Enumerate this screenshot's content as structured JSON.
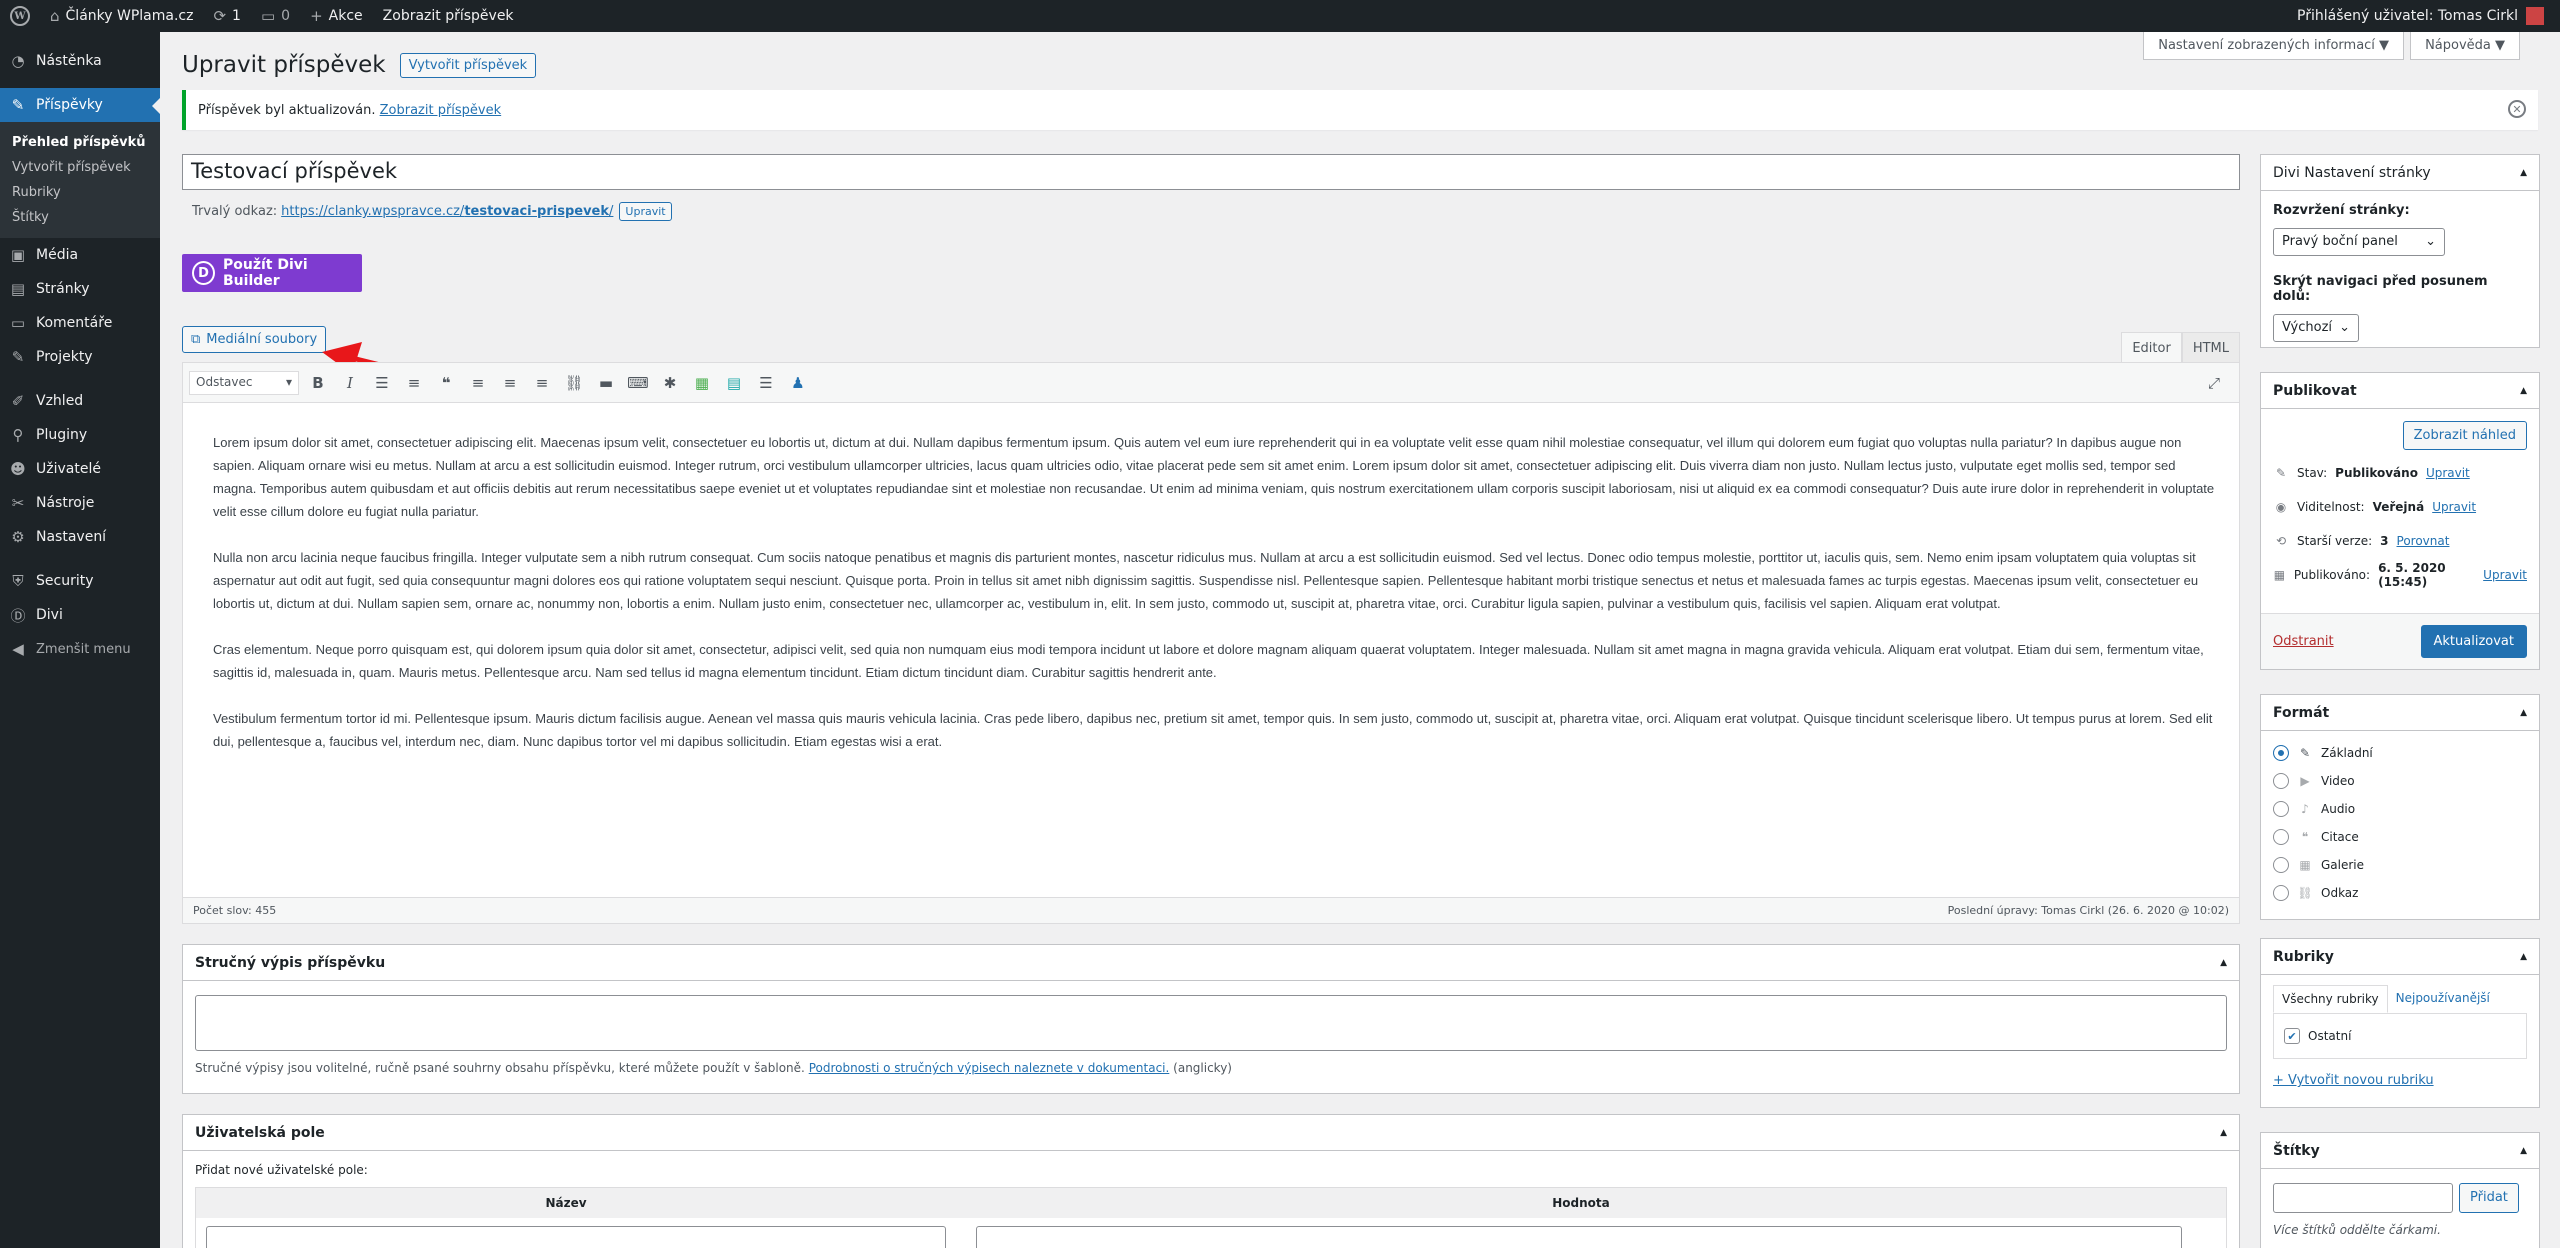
{
  "adminbar": {
    "site": "Články WPlama.cz",
    "updates": "1",
    "comments": "0",
    "new": "Akce",
    "view_post": "Zobrazit příspěvek",
    "greeting": "Přihlášený uživatel: Tomas Cirkl"
  },
  "sidebar": {
    "items": [
      {
        "label": "Nástěnka",
        "icon": "dashboard-icon"
      },
      {
        "label": "Příspěvky",
        "icon": "pin-icon"
      },
      {
        "label": "Média",
        "icon": "media-icon"
      },
      {
        "label": "Stránky",
        "icon": "pages-icon"
      },
      {
        "label": "Komentáře",
        "icon": "comments-icon"
      },
      {
        "label": "Projekty",
        "icon": "pin-icon"
      },
      {
        "label": "Vzhled",
        "icon": "appearance-icon"
      },
      {
        "label": "Pluginy",
        "icon": "plugins-icon"
      },
      {
        "label": "Uživatelé",
        "icon": "users-icon"
      },
      {
        "label": "Nástroje",
        "icon": "tools-icon"
      },
      {
        "label": "Nastavení",
        "icon": "settings-icon"
      },
      {
        "label": "Security",
        "icon": "shield-icon"
      },
      {
        "label": "Divi",
        "icon": "divi-icon"
      },
      {
        "label": "Zmenšit menu",
        "icon": "collapse-icon"
      }
    ],
    "submenu": [
      "Přehled příspěvků",
      "Vytvořit příspěvek",
      "Rubriky",
      "Štítky"
    ]
  },
  "header": {
    "title": "Upravit příspěvek",
    "add_new": "Vytvořit příspěvek",
    "screen_options": "Nastavení zobrazených informací ▼",
    "help": "Nápověda ▼"
  },
  "notice": {
    "text": "Příspěvek byl aktualizován.",
    "link": "Zobrazit příspěvek"
  },
  "post": {
    "title": "Testovací příspěvek",
    "permalink_label": "Trvalý odkaz:",
    "permalink_base": "https://clanky.wpspravce.cz/",
    "permalink_slug": "testovaci-prispevek",
    "permalink_end": "/",
    "permalink_edit": "Upravit"
  },
  "divi_button": "Použít Divi Builder",
  "media_button": "Mediální soubory",
  "editor": {
    "tab_visual": "Editor",
    "tab_html": "HTML",
    "format": "Odstavec",
    "paragraphs": [
      "Lorem ipsum dolor sit amet, consectetuer adipiscing elit. Maecenas ipsum velit, consectetuer eu lobortis ut, dictum at dui. Nullam dapibus fermentum ipsum. Quis autem vel eum iure reprehenderit qui in ea voluptate velit esse quam nihil molestiae consequatur, vel illum qui dolorem eum fugiat quo voluptas nulla pariatur? In dapibus augue non sapien. Aliquam ornare wisi eu metus. Nullam at arcu a est sollicitudin euismod. Integer rutrum, orci vestibulum ullamcorper ultricies, lacus quam ultricies odio, vitae placerat pede sem sit amet enim. Lorem ipsum dolor sit amet, consectetuer adipiscing elit. Duis viverra diam non justo. Nullam lectus justo, vulputate eget mollis sed, tempor sed magna. Temporibus autem quibusdam et aut officiis debitis aut rerum necessitatibus saepe eveniet ut et voluptates repudiandae sint et molestiae non recusandae. Ut enim ad minima veniam, quis nostrum exercitationem ullam corporis suscipit laboriosam, nisi ut aliquid ex ea commodi consequatur? Duis aute irure dolor in reprehenderit in voluptate velit esse cillum dolore eu fugiat nulla pariatur.",
      "Nulla non arcu lacinia neque faucibus fringilla. Integer vulputate sem a nibh rutrum consequat. Cum sociis natoque penatibus et magnis dis parturient montes, nascetur ridiculus mus. Nullam at arcu a est sollicitudin euismod. Sed vel lectus. Donec odio tempus molestie, porttitor ut, iaculis quis, sem. Nemo enim ipsam voluptatem quia voluptas sit aspernatur aut odit aut fugit, sed quia consequuntur magni dolores eos qui ratione voluptatem sequi nesciunt. Quisque porta. Proin in tellus sit amet nibh dignissim sagittis. Suspendisse nisl. Pellentesque sapien. Pellentesque habitant morbi tristique senectus et netus et malesuada fames ac turpis egestas. Maecenas ipsum velit, consectetuer eu lobortis ut, dictum at dui. Nullam sapien sem, ornare ac, nonummy non, lobortis a enim. Nullam justo enim, consectetuer nec, ullamcorper ac, vestibulum in, elit. In sem justo, commodo ut, suscipit at, pharetra vitae, orci. Curabitur ligula sapien, pulvinar a vestibulum quis, facilisis vel sapien. Aliquam erat volutpat.",
      "Cras elementum. Neque porro quisquam est, qui dolorem ipsum quia dolor sit amet, consectetur, adipisci velit, sed quia non numquam eius modi tempora incidunt ut labore et dolore magnam aliquam quaerat voluptatem. Integer malesuada. Nullam sit amet magna in magna gravida vehicula. Aliquam erat volutpat. Etiam dui sem, fermentum vitae, sagittis id, malesuada in, quam. Mauris metus. Pellentesque arcu. Nam sed tellus id magna elementum tincidunt. Etiam dictum tincidunt diam. Curabitur sagittis hendrerit ante.",
      "Vestibulum fermentum tortor id mi. Pellentesque ipsum. Mauris dictum facilisis augue. Aenean vel massa quis mauris vehicula lacinia. Cras pede libero, dapibus nec, pretium sit amet, tempor quis. In sem justo, commodo ut, suscipit at, pharetra vitae, orci. Aliquam erat volutpat. Quisque tincidunt scelerisque libero. Ut tempus purus at lorem. Sed elit dui, pellentesque a, faucibus vel, interdum nec, diam. Nunc dapibus tortor vel mi dapibus sollicitudin. Etiam egestas wisi a erat."
    ],
    "word_count": "Počet slov: 455",
    "last_edit": "Poslední úpravy: Tomas Cirkl (26. 6. 2020 @ 10:02)"
  },
  "excerpt": {
    "title": "Stručný výpis příspěvku",
    "help": "Stručné výpisy jsou volitelné, ručně psané souhrny obsahu příspěvku, které můžete použít v šabloně.",
    "help_link": "Podrobnosti o stručných výpisech naleznete v dokumentaci.",
    "help_end": "(anglicky)"
  },
  "custom_fields": {
    "title": "Uživatelská pole",
    "add_label": "Přidat nové uživatelské pole:",
    "col_name": "Název",
    "col_value": "Hodnota"
  },
  "divi_settings": {
    "title": "Divi Nastavení stránky",
    "layout_label": "Rozvržení stránky:",
    "layout_value": "Pravý boční panel",
    "nav_label": "Skrýt navigaci před posunem dolů:",
    "nav_value": "Výchozí"
  },
  "publish": {
    "title": "Publikovat",
    "preview": "Zobrazit náhled",
    "status_label": "Stav:",
    "status_value": "Publikováno",
    "visibility_label": "Viditelnost:",
    "visibility_value": "Veřejná",
    "revisions_label": "Starší verze:",
    "revisions_value": "3",
    "published_label": "Publikováno:",
    "published_value": "6. 5. 2020 (15:45)",
    "edit": "Upravit",
    "compare": "Porovnat",
    "trash": "Odstranit",
    "update": "Aktualizovat"
  },
  "format": {
    "title": "Formát",
    "options": [
      {
        "label": "Základní",
        "icon": "pin-icon",
        "checked": true
      },
      {
        "label": "Video",
        "icon": "video-icon",
        "checked": false
      },
      {
        "label": "Audio",
        "icon": "audio-icon",
        "checked": false
      },
      {
        "label": "Citace",
        "icon": "quote-icon",
        "checked": false
      },
      {
        "label": "Galerie",
        "icon": "gallery-icon",
        "checked": false
      },
      {
        "label": "Odkaz",
        "icon": "link-icon",
        "checked": false
      }
    ]
  },
  "categories": {
    "title": "Rubriky",
    "tab_all": "Všechny rubriky",
    "tab_popular": "Nejpoužívanější",
    "item": "Ostatní",
    "add_new": "+ Vytvořit novou rubriku"
  },
  "tags": {
    "title": "Štítky",
    "add": "Přidat",
    "help": "Více štítků oddělte čárkami."
  },
  "colors": {
    "admin_dark": "#1d2327",
    "accent": "#2271b1",
    "divi": "#7e3bd0",
    "success": "#00a32a",
    "danger": "#b32d2e"
  }
}
